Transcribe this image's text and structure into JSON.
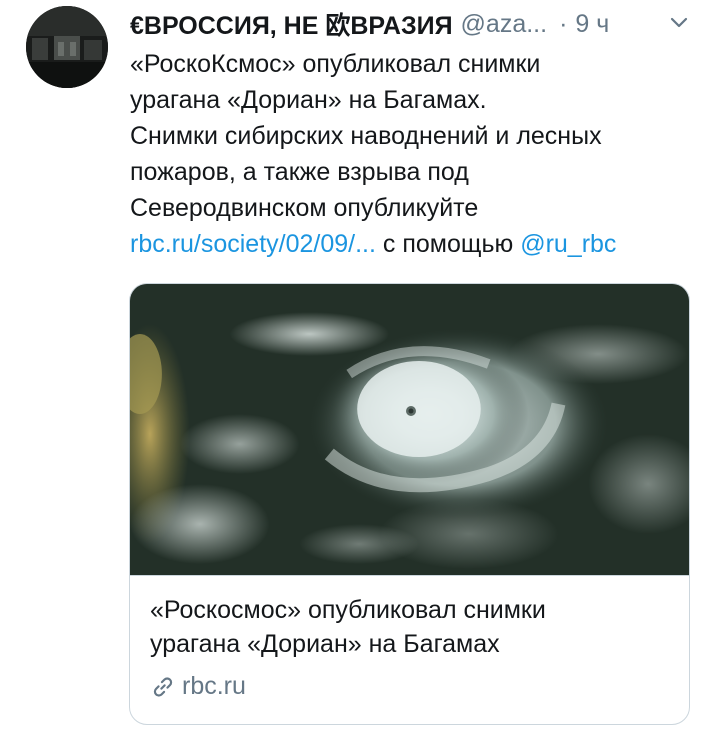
{
  "author": {
    "name": "€ВРОССИЯ, НЕ 欧ВРАЗИЯ",
    "handle": "@aza...",
    "separator": "·",
    "time": "9 ч"
  },
  "icons": {
    "more": "chevron-down-icon",
    "link": "link-icon"
  },
  "colors": {
    "link": "#1b95e0",
    "secondary_text": "#657786",
    "border": "#ccd6dd"
  },
  "tweet": {
    "lines": [
      "«РоскоКсмос» опубликовал снимки",
      "урагана «Дориан» на Багамах.",
      "Снимки сибирских наводнений и лесных",
      "пожаров, а также взрыва под",
      "Северодвинском опубликуйте"
    ],
    "url": "rbc.ru/society/02/09/...",
    "via_text": "с помощью",
    "mention": "@ru_rbc"
  },
  "card": {
    "image_alt": "satellite-image-hurricane",
    "title_lines": [
      "«Роскосмос» опубликовал снимки",
      "урагана «Дориан» на Багамах"
    ],
    "domain": "rbc.ru"
  }
}
